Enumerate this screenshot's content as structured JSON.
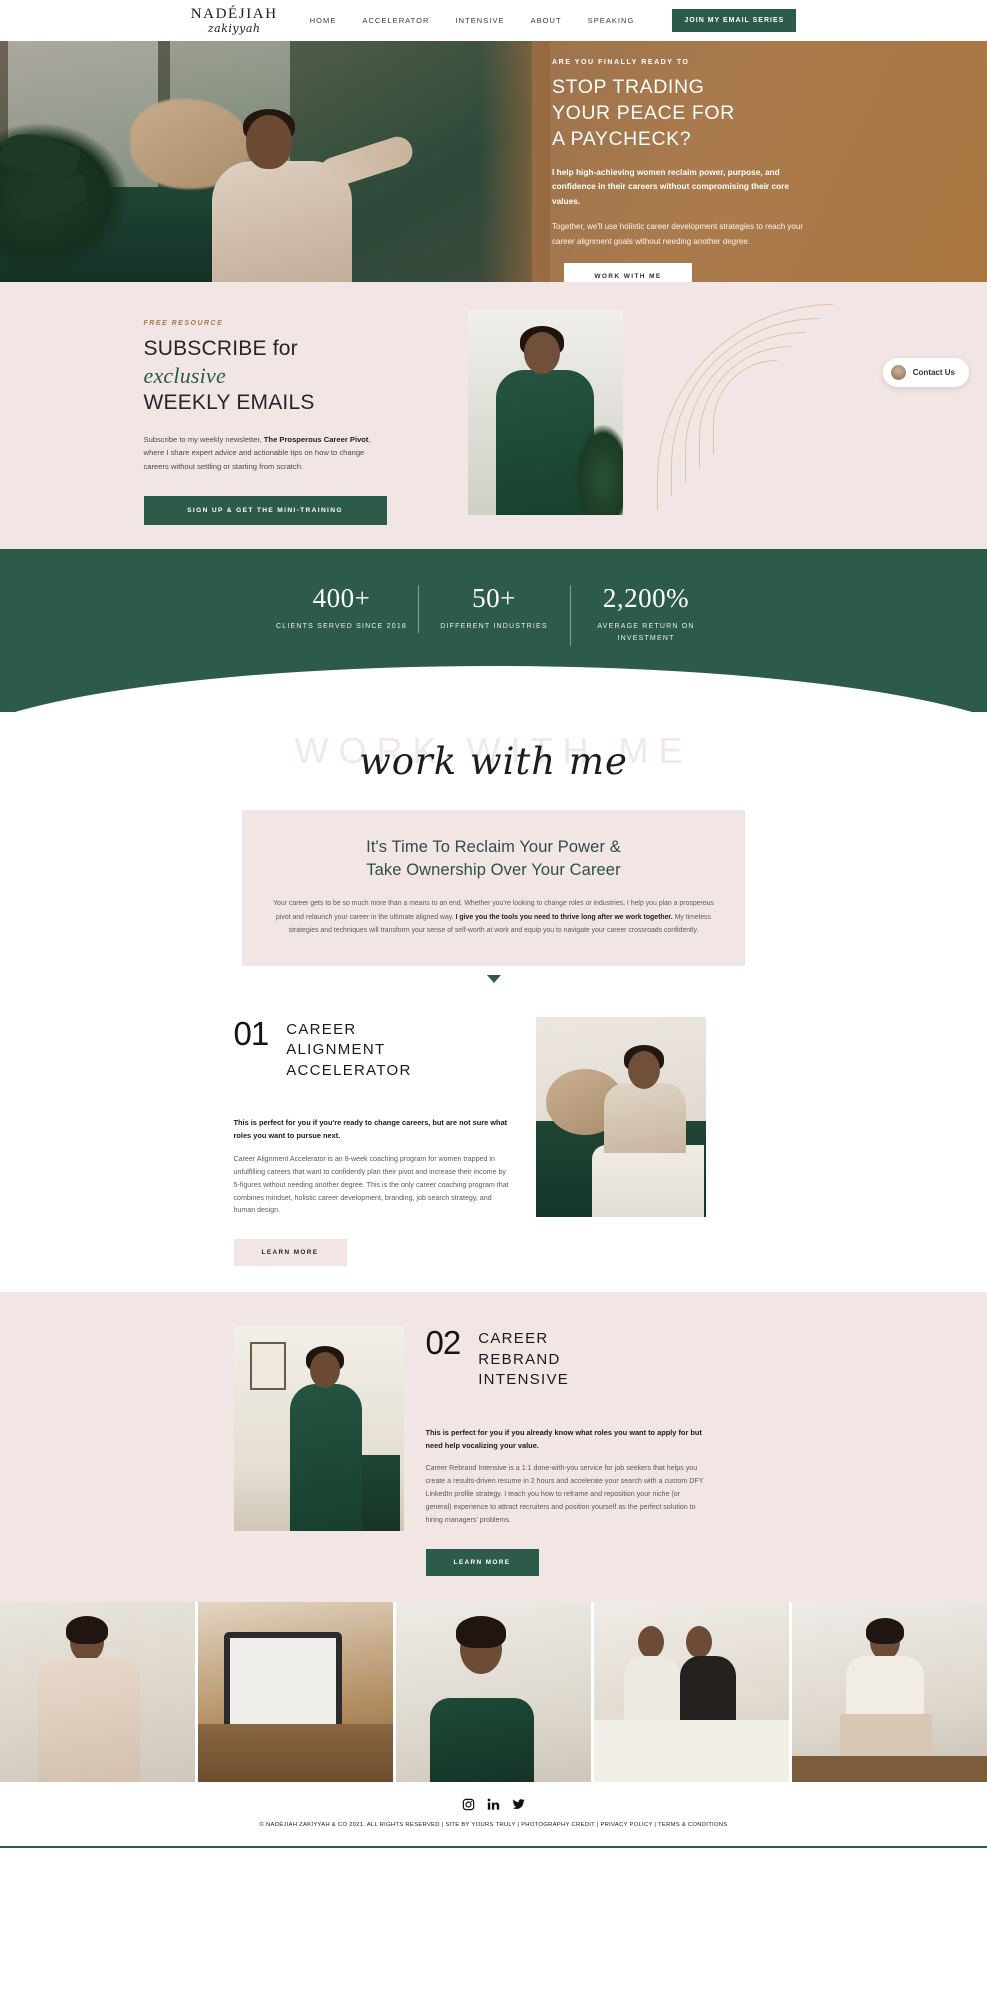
{
  "nav": {
    "brand_top": "NADÉJIAH",
    "brand_sub": "zakiyyah",
    "links": [
      {
        "label": "HOME"
      },
      {
        "label": "ACCELERATOR"
      },
      {
        "label": "INTENSIVE"
      },
      {
        "label": "ABOUT"
      },
      {
        "label": "SPEAKING"
      }
    ],
    "cta": "JOIN MY EMAIL SERIES"
  },
  "hero": {
    "eyebrow": "ARE YOU FINALLY READY TO",
    "title_line1": "STOP TRADING",
    "title_line2": "YOUR PEACE FOR",
    "title_line3": "A PAYCHECK?",
    "lead": "I help high-achieving women reclaim power, purpose, and confidence in their careers without compromising their core values.",
    "sub": "Together, we'll use holistic career development strategies to reach your career alignment goals without needing another degree.",
    "button": "WORK WITH ME"
  },
  "subscribe": {
    "eyebrow": "FREE RESOURCE",
    "head_line1": "SUBSCRIBE for",
    "head_italic": "exclusive",
    "head_line3": "WEEKLY EMAILS",
    "body_pre": "Subscribe to my weekly newsletter, ",
    "body_bold": "The Prosperous Career Pivot",
    "body_post": ", where I share expert advice and actionable tips on how to change careers without settling or starting from scratch.",
    "button": "SIGN UP & GET THE MINI-TRAINING"
  },
  "contact_widget": {
    "label": "Contact Us"
  },
  "stats": [
    {
      "number": "400+",
      "label": "CLIENTS SERVED SINCE 2018"
    },
    {
      "number": "50+",
      "label": "DIFFERENT INDUSTRIES"
    },
    {
      "number": "2,200%",
      "label": "AVERAGE RETURN ON INVESTMENT"
    }
  ],
  "work_with_me": {
    "ghost": "WORK WITH ME",
    "script": "work with me"
  },
  "reclaim": {
    "heading_line1": "It's Time To Reclaim Your Power &",
    "heading_line2": "Take Ownership Over Your Career",
    "para_1": "Your career gets to be so much more than a means to an end. Whether you're looking to change roles or industries, I help you plan a prosperous pivot and relaunch your career in the ultimate aligned way. ",
    "para_bold": "I give you the tools you need to thrive long after we work together.",
    "para_2": " My timeless strategies and techniques will transform your sense of self-worth at work and equip you to navigate your career crossroads confidently."
  },
  "services": [
    {
      "number": "01",
      "title_line1": "CAREER",
      "title_line2": "ALIGNMENT",
      "title_line3": "ACCELERATOR",
      "lead": "This is perfect for you if you're ready to change careers, but are not sure what roles you want to pursue next.",
      "body": "Career Alignment Accelerator is an 8-week coaching program for women trapped in unfulfilling careers that want to confidently plan their pivot and increase their income by 5-figures without needing another degree. This is the only career coaching program that combines mindset, holistic career development, branding, job search strategy, and human design.",
      "button": "LEARN MORE"
    },
    {
      "number": "02",
      "title_line1": "CAREER",
      "title_line2": "REBRAND",
      "title_line3": "INTENSIVE",
      "lead": "This is perfect for you if you already know what roles you want to apply for but need help vocalizing your value.",
      "body": "Career Rebrand Intensive is a 1:1 done-with-you service for job seekers that helps you create a results-driven resume in 2 hours and accelerate your search with a custom DFY LinkedIn profile strategy. I teach you how to reframe and reposition your niche (or general) experience to attract recruiters and position yourself as the perfect solution to hiring managers' problems.",
      "button": "LEARN MORE"
    }
  ],
  "gallery": [
    {
      "alt": "woman-in-blush-blouse"
    },
    {
      "alt": "hands-holding-tablet"
    },
    {
      "alt": "woman-in-green-sweater-portrait"
    },
    {
      "alt": "two-women-on-sofa"
    },
    {
      "alt": "woman-working-on-laptop"
    }
  ],
  "footer": {
    "socials": [
      {
        "name": "instagram"
      },
      {
        "name": "linkedin"
      },
      {
        "name": "twitter"
      }
    ],
    "copyright": "© NADÉJIAH ZAKIYYAH & CO 2021. ALL RIGHTS RESERVED | SITE BY YOURS TRULY | PHOTOGRAPHY CREDIT | PRIVACY POLICY | TERMS & CONDITIONS"
  },
  "colors": {
    "green": "#2d5b4a",
    "pink": "#f2e6e4",
    "tan": "#a9763f",
    "gold": "#a57a4e"
  }
}
